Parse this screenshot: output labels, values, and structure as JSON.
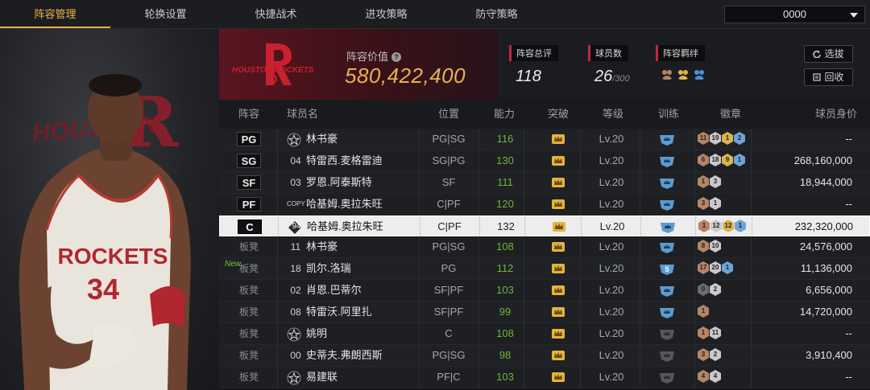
{
  "nav": {
    "tabs": [
      {
        "label": "阵容管理",
        "active": true
      },
      {
        "label": "轮换设置",
        "active": false
      },
      {
        "label": "快捷战术",
        "active": false
      },
      {
        "label": "进攻策略",
        "active": false
      },
      {
        "label": "防守策略",
        "active": false
      }
    ],
    "selector_value": "0000"
  },
  "hero": {
    "bg_text": "HOUSTON",
    "bg_letter": "R",
    "jersey_team": "ROCKETS",
    "jersey_number": "34"
  },
  "team": {
    "logo_text": "HOUSTON ROCKETS",
    "value_label": "阵容价值",
    "value": "580,422,400",
    "accent_color": "#e8b24e"
  },
  "stats": {
    "overall_label": "阵容总评",
    "overall_value": "118",
    "players_label": "球员数",
    "players_value": "26",
    "players_max": "/300",
    "bonds_label": "阵容羁绊",
    "bond_icons": [
      "bond-bronze-icon",
      "bond-gold-icon",
      "bond-blue-icon"
    ]
  },
  "buttons": {
    "pick": "选拔",
    "recycle": "回收"
  },
  "table": {
    "headers": {
      "lineup": "阵容",
      "name": "球员名",
      "position": "位置",
      "rating": "能力",
      "breakthrough": "突破",
      "level": "等级",
      "training": "训练",
      "badges": "徽章",
      "value": "球员身价"
    },
    "rows": [
      {
        "slot": "PG",
        "starter": true,
        "num": "",
        "star": true,
        "name": "林书豪",
        "pos": "PG|SG",
        "rating": "116",
        "level": "Lv.20",
        "train": "",
        "badges": [
          [
            "b",
            "11"
          ],
          [
            "s",
            "19"
          ],
          [
            "g",
            "1"
          ],
          [
            "h",
            "2"
          ]
        ],
        "value": "--"
      },
      {
        "slot": "SG",
        "starter": true,
        "num": "04",
        "name": "特雷西.麦格雷迪",
        "pos": "SG|PG",
        "rating": "130",
        "level": "Lv.20",
        "train": "",
        "badges": [
          [
            "b",
            "6"
          ],
          [
            "s",
            "18"
          ],
          [
            "g",
            "9"
          ],
          [
            "h",
            "1"
          ]
        ],
        "value": "268,160,000"
      },
      {
        "slot": "SF",
        "starter": true,
        "num": "03",
        "name": "罗恩.阿泰斯特",
        "pos": "SF",
        "rating": "111",
        "level": "Lv.20",
        "train": "",
        "badges": [
          [
            "b",
            "1"
          ],
          [
            "s",
            "3"
          ]
        ],
        "value": "18,944,000"
      },
      {
        "slot": "PF",
        "starter": true,
        "num": "COPY",
        "name": "哈基姆.奥拉朱旺",
        "pos": "C|PF",
        "rating": "120",
        "level": "Lv.20",
        "train": "",
        "badges": [
          [
            "b",
            "3"
          ],
          [
            "s",
            "1"
          ]
        ],
        "value": "--"
      },
      {
        "slot": "C",
        "starter": true,
        "selected": true,
        "num": "94",
        "name": "哈基姆.奥拉朱旺",
        "pos": "C|PF",
        "rating": "132",
        "level": "Lv.20",
        "train": "",
        "badges": [
          [
            "b",
            "1"
          ],
          [
            "s",
            "12"
          ],
          [
            "g",
            "12"
          ],
          [
            "h",
            "1"
          ]
        ],
        "value": "232,320,000"
      },
      {
        "slot": "板凳",
        "num": "11",
        "name": "林书豪",
        "pos": "PG|SG",
        "rating": "108",
        "level": "Lv.20",
        "train": "",
        "badges": [
          [
            "b",
            "8"
          ],
          [
            "s",
            "10"
          ]
        ],
        "value": "24,576,000"
      },
      {
        "slot": "板凳",
        "new": "New",
        "num": "18",
        "name": "凯尔.洛瑞",
        "pos": "PG",
        "rating": "112",
        "level": "Lv.20",
        "train": "5",
        "badges": [
          [
            "b",
            "17"
          ],
          [
            "s",
            "20"
          ],
          [
            "h",
            "1"
          ]
        ],
        "value": "11,136,000"
      },
      {
        "slot": "板凳",
        "num": "02",
        "name": "肖恩.巴蒂尔",
        "pos": "SF|PF",
        "rating": "103",
        "level": "Lv.20",
        "train": "",
        "badges": [
          [
            "d",
            "0"
          ],
          [
            "s",
            "2"
          ]
        ],
        "value": "6,656,000"
      },
      {
        "slot": "板凳",
        "num": "08",
        "name": "特雷沃.阿里扎",
        "pos": "SF|PF",
        "rating": "99",
        "level": "Lv.20",
        "train": "",
        "badges": [
          [
            "b",
            "1"
          ]
        ],
        "value": "14,720,000"
      },
      {
        "slot": "板凳",
        "num": "",
        "star": true,
        "name": "姚明",
        "pos": "C",
        "rating": "108",
        "level": "Lv.20",
        "train": "gray",
        "badges": [
          [
            "b",
            "1"
          ],
          [
            "s",
            "11"
          ]
        ],
        "value": "--"
      },
      {
        "slot": "板凳",
        "num": "00",
        "name": "史蒂夫.弗朗西斯",
        "pos": "PG|SG",
        "rating": "98",
        "level": "Lv.20",
        "train": "gray",
        "badges": [
          [
            "b",
            "3"
          ],
          [
            "s",
            "2"
          ]
        ],
        "value": "3,910,400"
      },
      {
        "slot": "板凳",
        "num": "",
        "star": true,
        "name": "易建联",
        "pos": "PF|C",
        "rating": "103",
        "level": "Lv.20",
        "train": "gray",
        "badges": [
          [
            "b",
            "4"
          ],
          [
            "s",
            "4"
          ]
        ],
        "value": "--"
      }
    ]
  }
}
